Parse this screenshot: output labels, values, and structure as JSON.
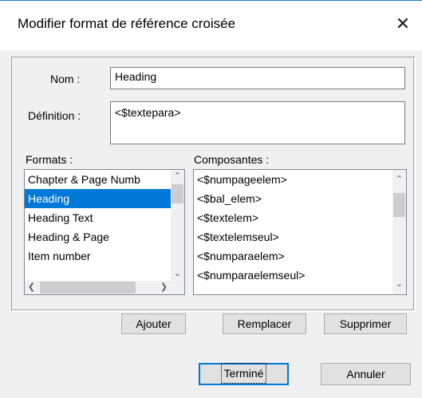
{
  "dialog": {
    "title": "Modifier format de référence croisée",
    "close_glyph": "✕"
  },
  "nom": {
    "label": "Nom :",
    "value": "Heading"
  },
  "definition": {
    "label": "Définition :",
    "value": "<$textepara>"
  },
  "formats": {
    "label": "Formats :",
    "items": [
      "Chapter & Page Numb",
      "Heading",
      "Heading Text",
      "Heading & Page",
      "Item number"
    ],
    "selected": "Heading"
  },
  "composantes": {
    "label": "Composantes :",
    "items": [
      "<$numpageelem>",
      "<$bal_elem>",
      "<$textelem>",
      "<$textelemseul>",
      "<$numparaelem>",
      "<$numparaelemseul>"
    ]
  },
  "buttons": {
    "ajouter": "Ajouter",
    "remplacer": "Remplacer",
    "supprimer": "Supprimer",
    "termine": "Terminé",
    "annuler": "Annuler"
  },
  "icons": {
    "arrow_up": "⌃",
    "arrow_down": "⌄",
    "arrow_left": "❮",
    "arrow_right": "❯"
  }
}
